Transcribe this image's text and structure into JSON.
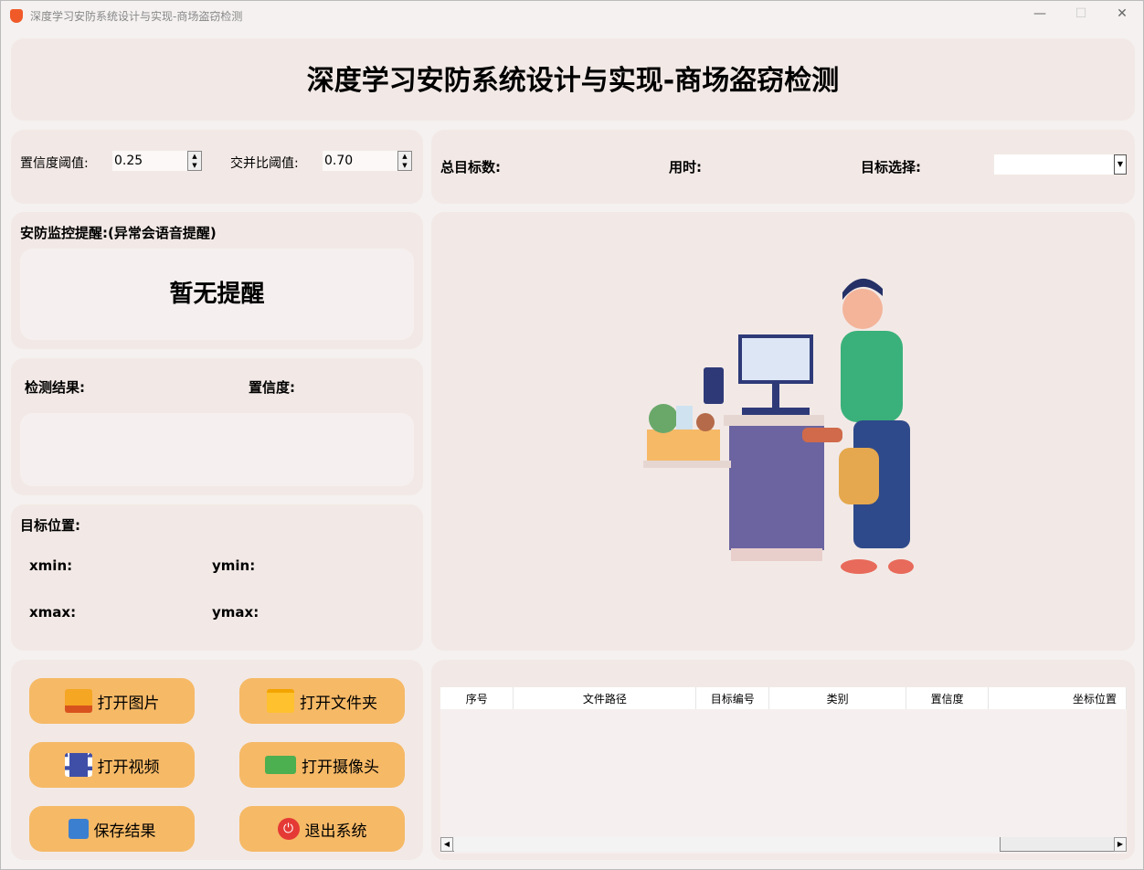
{
  "window": {
    "title": "深度学习安防系统设计与实现-商场盗窃检测",
    "minimize": "—",
    "maximize": "☐",
    "close": "✕"
  },
  "header": {
    "title": "深度学习安防系统设计与实现-商场盗窃检测"
  },
  "params": {
    "conf_label": "置信度阈值:",
    "conf_value": "0.25",
    "iou_label": "交并比阈值:",
    "iou_value": "0.70"
  },
  "stats": {
    "total_label": "总目标数:",
    "time_label": "用时:",
    "select_label": "目标选择:",
    "select_value": ""
  },
  "alert": {
    "label": "安防监控提醒:(异常会语音提醒)",
    "message": "暂无提醒"
  },
  "result": {
    "label": "检测结果:",
    "conf_label": "置信度:"
  },
  "position": {
    "label": "目标位置:",
    "xmin": "xmin:",
    "ymin": "ymin:",
    "xmax": "xmax:",
    "ymax": "ymax:"
  },
  "buttons": {
    "open_image": "打开图片",
    "open_folder": "打开文件夹",
    "open_video": "打开视频",
    "open_camera": "打开摄像头",
    "save": "保存结果",
    "exit": "退出系统"
  },
  "table": {
    "columns": [
      "序号",
      "文件路径",
      "目标编号",
      "类别",
      "置信度",
      "坐标位置"
    ]
  }
}
